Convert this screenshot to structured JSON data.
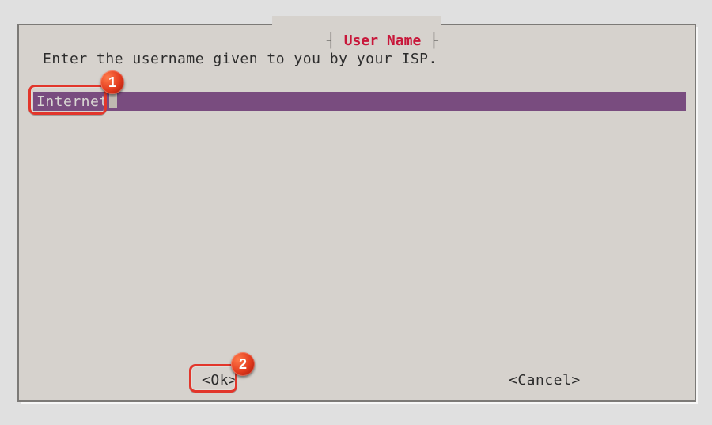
{
  "dialog": {
    "title": "User Name",
    "prompt": "Enter the username given to you by your ISP.",
    "input_value": "Internet"
  },
  "buttons": {
    "ok": "<Ok>",
    "cancel": "<Cancel>"
  },
  "annotations": {
    "badge1": "1",
    "badge2": "2"
  }
}
